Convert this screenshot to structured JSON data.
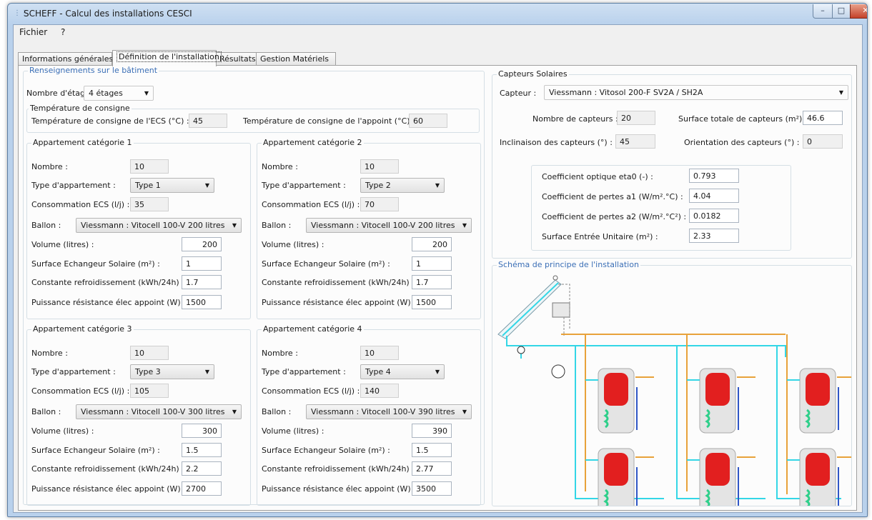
{
  "window": {
    "title": "SCHEFF - Calcul des installations CESCI",
    "minimize": "–",
    "maximize": "□",
    "close": "✕",
    "app_icon": "grid-icon"
  },
  "menu": {
    "file": "Fichier",
    "help": "?"
  },
  "tabs": [
    "Informations générales",
    "Définition de l'installation",
    "Résultats",
    "Gestion Matériels"
  ],
  "building": {
    "title": "Renseignements sur le bâtiment",
    "floors_label": "Nombre d'étages :",
    "floors_value": "4 étages",
    "setpoint": {
      "title": "Température de consigne",
      "ecs_label": "Température de consigne de l'ECS (°C) :",
      "ecs_value": "45",
      "backup_label": "Température de consigne de l'appoint (°C) :",
      "backup_value": "60"
    }
  },
  "field_labels": {
    "count": "Nombre :",
    "type": "Type d'appartement :",
    "ecs": "Consommation ECS (l/j) :",
    "tank": "Ballon :",
    "volume": "Volume (litres) :",
    "exchanger": "Surface Echangeur Solaire (m²) :",
    "cooling": "Constante refroidissement (kWh/24h) :",
    "power": "Puissance résistance élec appoint (W) :"
  },
  "apartments": [
    {
      "title": "Appartement catégorie 1",
      "count": "10",
      "type": "Type 1",
      "ecs": "35",
      "tank": "Viessmann : Vitocell 100-V 200 litres",
      "volume": "200",
      "exchanger": "1",
      "cooling": "1.7",
      "power": "1500"
    },
    {
      "title": "Appartement catégorie 2",
      "count": "10",
      "type": "Type 2",
      "ecs": "70",
      "tank": "Viessmann : Vitocell 100-V 200 litres",
      "volume": "200",
      "exchanger": "1",
      "cooling": "1.7",
      "power": "1500"
    },
    {
      "title": "Appartement catégorie 3",
      "count": "10",
      "type": "Type 3",
      "ecs": "105",
      "tank": "Viessmann : Vitocell 100-V 300 litres",
      "volume": "300",
      "exchanger": "1.5",
      "cooling": "2.2",
      "power": "2700"
    },
    {
      "title": "Appartement catégorie 4",
      "count": "10",
      "type": "Type 4",
      "ecs": "140",
      "tank": "Viessmann : Vitocell 100-V 390 litres",
      "volume": "390",
      "exchanger": "1.5",
      "cooling": "2.77",
      "power": "3500"
    }
  ],
  "collectors": {
    "title": "Capteurs Solaires",
    "model_label": "Capteur :",
    "model_value": "Viessmann : Vitosol 200-F SV2A / SH2A",
    "count_label": "Nombre de capteurs :",
    "count_value": "20",
    "total_area_label": "Surface totale de capteurs (m²) :",
    "total_area_value": "46.6",
    "tilt_label": "Inclinaison des capteurs (°) :",
    "tilt_value": "45",
    "orientation_label": "Orientation des capteurs (°) :",
    "orientation_value": "0",
    "eta0_label": "Coefficient optique eta0 (-) :",
    "eta0_value": "0.793",
    "a1_label": "Coefficient de pertes a1 (W/m².°C) :",
    "a1_value": "4.04",
    "a2_label": "Coefficient de pertes a2 (W/m².°C²) :",
    "a2_value": "0.0182",
    "unit_area_label": "Surface Entrée Unitaire (m²) :",
    "unit_area_value": "2.33"
  },
  "schema": {
    "title": "Schéma de principe de l'installation"
  },
  "colors": {
    "solar_loop": "#33d6e6",
    "hot_water": "#e8a23a",
    "cold_water": "#2f56c6",
    "tank_heat": "#e21f1f",
    "coil": "#2ecf8a"
  }
}
